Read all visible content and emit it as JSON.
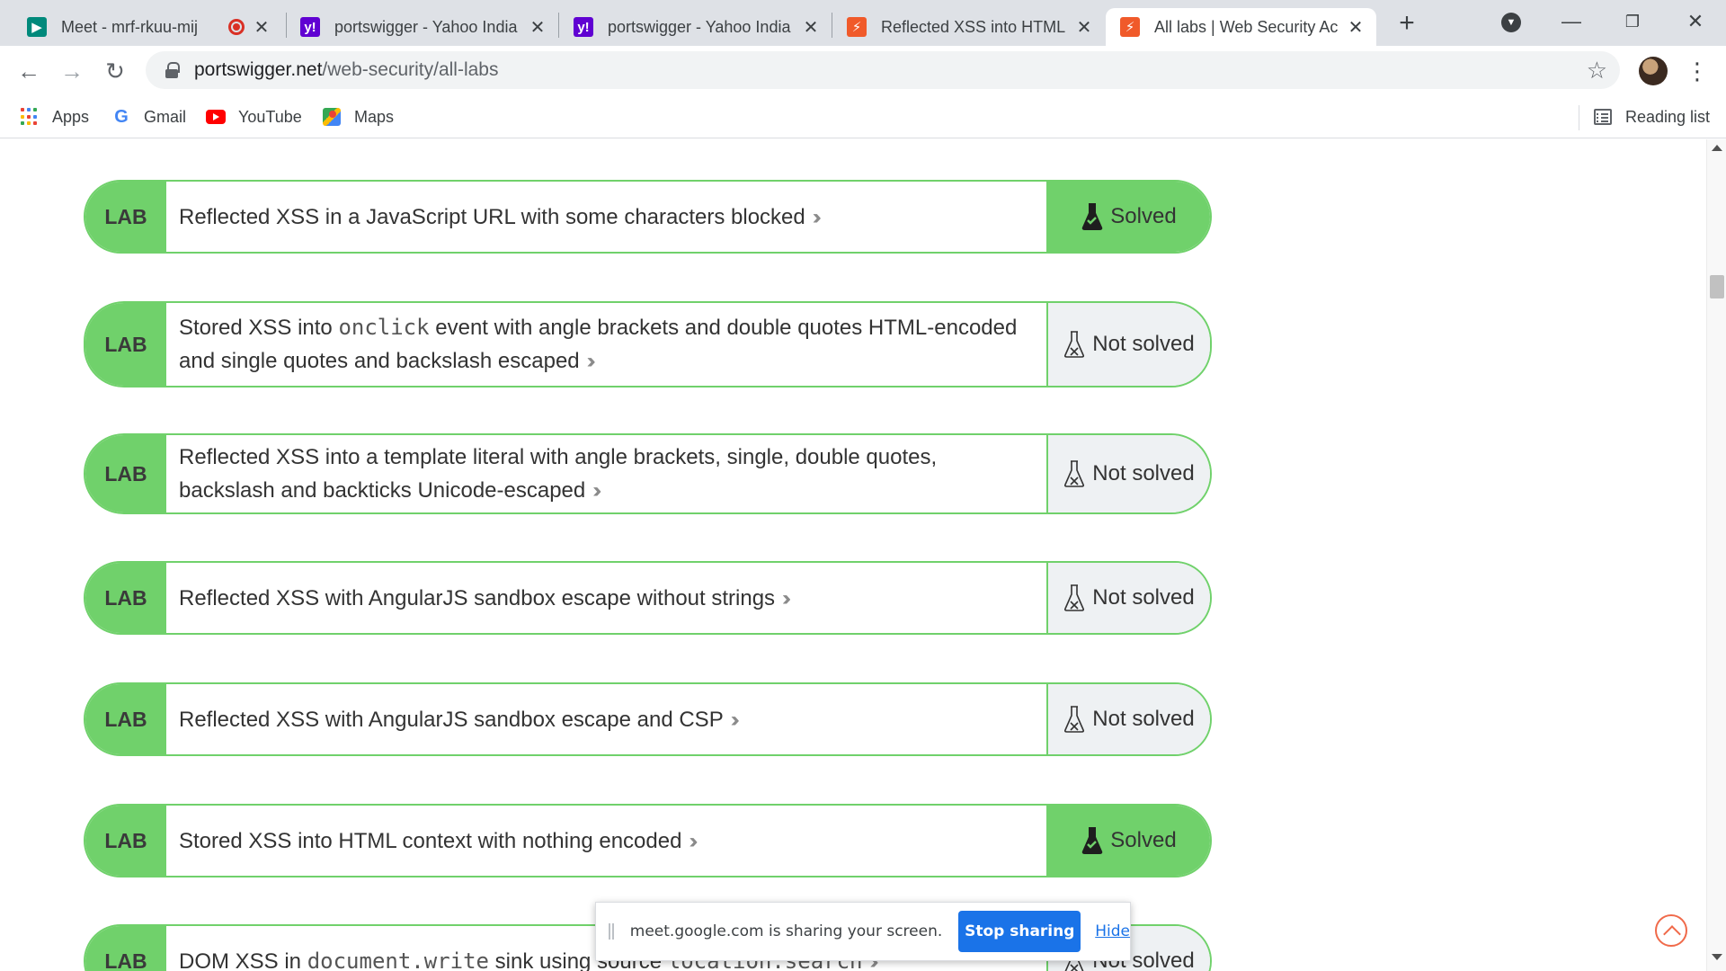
{
  "tabs": [
    {
      "title": "Meet - mrf-rkuu-mij",
      "icon": "google-meet-icon",
      "recording": true
    },
    {
      "title": "portswigger - Yahoo India",
      "icon": "yahoo-icon"
    },
    {
      "title": "portswigger - Yahoo India",
      "icon": "yahoo-icon"
    },
    {
      "title": "Reflected XSS into HTML c",
      "icon": "portswigger-icon"
    },
    {
      "title": "All labs | Web Security Ac",
      "icon": "portswigger-icon",
      "active": true
    }
  ],
  "address": {
    "host": "portswigger.net",
    "path": "/web-security/all-labs"
  },
  "bookmarks": [
    {
      "label": "Apps",
      "icon": "apps-grid-icon"
    },
    {
      "label": "Gmail",
      "icon": "google-icon"
    },
    {
      "label": "YouTube",
      "icon": "youtube-icon"
    },
    {
      "label": "Maps",
      "icon": "maps-icon"
    }
  ],
  "reading_list": "Reading list",
  "lab_tag": "LAB",
  "labs": [
    {
      "text_before": "Reflected XSS in a JavaScript URL with some characters blocked",
      "status": "Solved"
    },
    {
      "text_before": "Stored XSS into ",
      "code": "onclick",
      "text_after": " event with angle brackets and double quotes HTML-encoded and single quotes and backslash escaped",
      "status": "Not solved"
    },
    {
      "text_before": "Reflected XSS into a template literal with angle brackets, single, double quotes, backslash and backticks Unicode-escaped",
      "status": "Not solved"
    },
    {
      "text_before": "Reflected XSS with AngularJS sandbox escape without strings",
      "status": "Not solved"
    },
    {
      "text_before": "Reflected XSS with AngularJS sandbox escape and CSP",
      "status": "Not solved"
    },
    {
      "text_before": "Stored XSS into HTML context with nothing encoded",
      "status": "Solved"
    },
    {
      "text_before": "DOM XSS in ",
      "code": "document.write",
      "text_after": " sink using source ",
      "code2": "location.search",
      "status": "Not solved"
    }
  ],
  "sharebar": {
    "message": "meet.google.com is sharing your screen.",
    "stop_label": "Stop sharing",
    "hide_label": "Hide"
  },
  "colors": {
    "lab_green": "#70d16b",
    "unsolved_bg": "#eef1f3",
    "accent_blue": "#1a73e8"
  }
}
